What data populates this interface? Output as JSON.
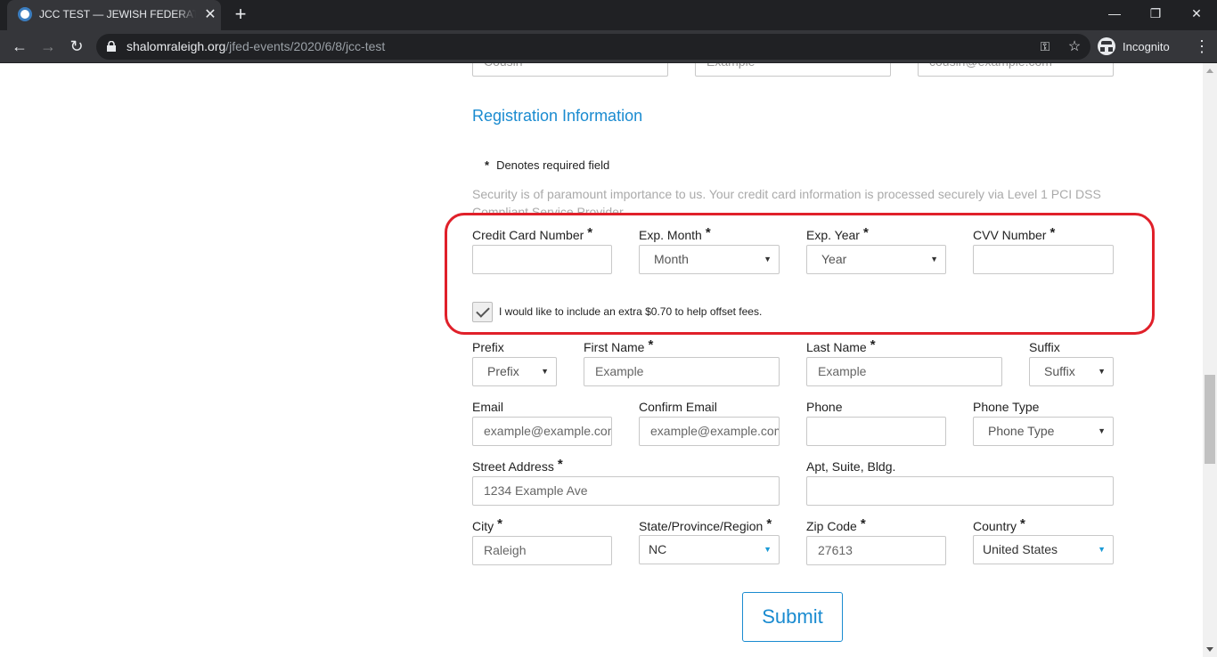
{
  "browser": {
    "tab_title": "JCC TEST — JEWISH FEDERATION OF RALEIGH-CARY",
    "tab_close": "✕",
    "new_tab": "+",
    "url_host": "shalomraleigh.org",
    "url_path": "/jfed-events/2020/6/8/jcc-test",
    "incognito_label": "Incognito",
    "minimize": "—",
    "restore": "❐",
    "close": "✕"
  },
  "top_row_partial": {
    "relationship": "Cousin",
    "last_name": "Example",
    "email": "cousin@example.com"
  },
  "section_title": "Registration Information",
  "required_note": "Denotes required field",
  "required_star": "*",
  "security_text": "Security is of paramount importance to us. Your credit card information is processed securely via Level 1 PCI DSS Compliant Service Provider.",
  "payment": {
    "card_number_label": "Credit Card Number",
    "exp_month_label": "Exp. Month",
    "exp_month_value": "Month",
    "exp_year_label": "Exp. Year",
    "exp_year_value": "Year",
    "cvv_label": "CVV Number",
    "fee_checkbox_label": "I would like to include an extra $0.70 to help offset fees.",
    "fee_checked": true
  },
  "registrant": {
    "prefix_label": "Prefix",
    "prefix_value": "Prefix",
    "first_name_label": "First Name",
    "first_name_placeholder": "Example",
    "last_name_label": "Last Name",
    "last_name_placeholder": "Example",
    "suffix_label": "Suffix",
    "suffix_value": "Suffix",
    "email_label": "Email",
    "email_placeholder": "example@example.com",
    "confirm_email_label": "Confirm Email",
    "confirm_email_placeholder": "example@example.com",
    "phone_label": "Phone",
    "phone_type_label": "Phone Type",
    "phone_type_value": "Phone Type",
    "street_label": "Street Address",
    "street_placeholder": "1234 Example Ave",
    "apt_label": "Apt, Suite, Bldg.",
    "city_label": "City",
    "city_placeholder": "Raleigh",
    "state_label": "State/Province/Region",
    "state_value": "NC",
    "zip_label": "Zip Code",
    "zip_placeholder": "27613",
    "country_label": "Country",
    "country_value": "United States"
  },
  "submit_label": "Submit",
  "icons": {
    "caret": "▼",
    "back": "←",
    "forward": "→",
    "reload": "↻",
    "star": "☆",
    "menu": "⋮",
    "key": "⚿"
  },
  "colors": {
    "accent": "#1a8bd0",
    "highlight": "#e0202a"
  }
}
